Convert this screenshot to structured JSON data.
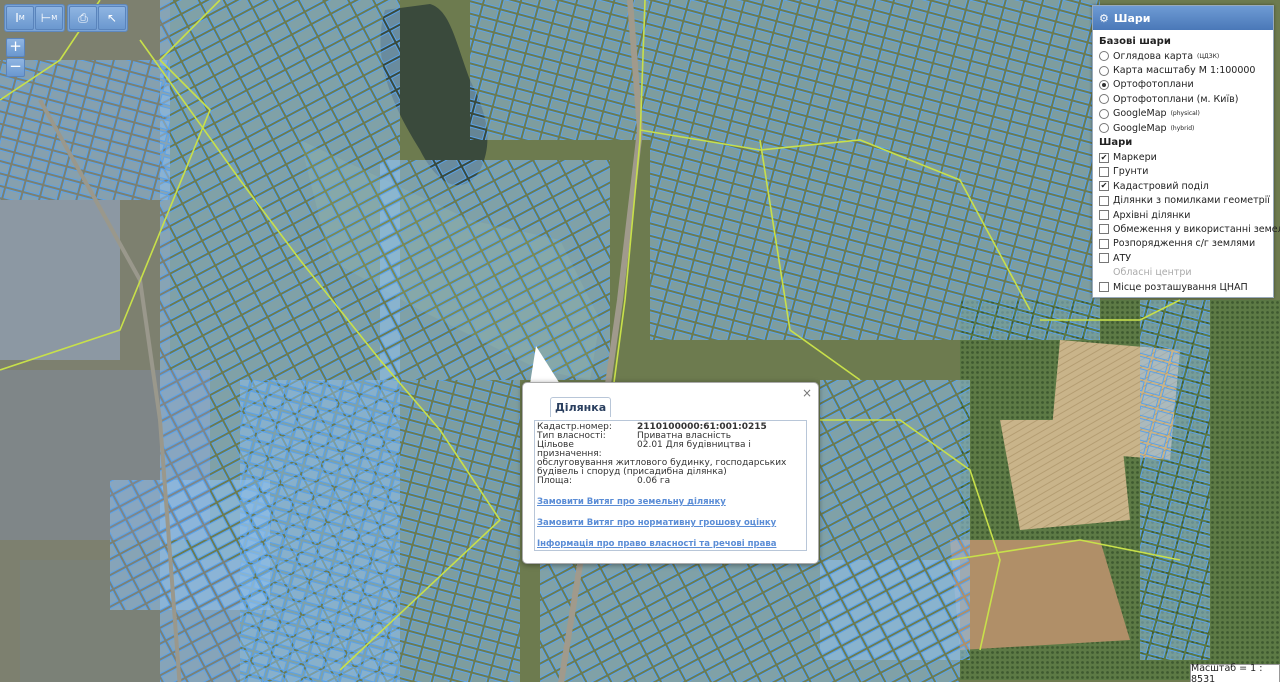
{
  "toolbar": {
    "ruler_label": "М",
    "area_label": "М"
  },
  "zoom": {
    "in": "+",
    "out": "−"
  },
  "layers_panel": {
    "title": "Шари",
    "base_section": "Базові шари",
    "base_layers": [
      {
        "label": "Оглядова карта",
        "sup": "(ЦДЗК)",
        "selected": false
      },
      {
        "label": "Карта масштабу М 1:100000",
        "sup": "",
        "selected": false
      },
      {
        "label": "Ортофотоплани",
        "sup": "",
        "selected": true
      },
      {
        "label": "Ортофотоплани (м. Київ)",
        "sup": "",
        "selected": false
      },
      {
        "label": "GoogleMap",
        "sup": "(physical)",
        "selected": false
      },
      {
        "label": "GoogleMap",
        "sup": "(hybrid)",
        "selected": false
      }
    ],
    "overlay_section": "Шари",
    "overlays": [
      {
        "label": "Маркери",
        "checked": true
      },
      {
        "label": "Грунти",
        "checked": false
      },
      {
        "label": "Кадастровий поділ",
        "checked": true
      },
      {
        "label": "Ділянки з помилками геометрії",
        "checked": false
      },
      {
        "label": "Архівні ділянки",
        "checked": false
      },
      {
        "label": "Обмеження у використанні земель",
        "checked": false
      },
      {
        "label": "Розпорядження с/г землями",
        "checked": false
      },
      {
        "label": "АТУ",
        "checked": false
      },
      {
        "label": "Обласні центри",
        "checked": false,
        "disabled": true
      },
      {
        "label": "Місце розташування ЦНАП",
        "checked": false
      }
    ]
  },
  "popup": {
    "tab": "Ділянка",
    "close": "×",
    "cadastral_label": "Кадастр.номер:",
    "cadastral_value": "2110100000:61:001:0215",
    "ownership_label": "Тип власності:",
    "ownership_value": "Приватна власність",
    "purpose_label": "Цільове призначення:",
    "purpose_value_1": "02.01 Для будівництва і",
    "purpose_value_2": "обслуговування житлового будинку, господарських будівель і споруд (присадибна ділянка)",
    "area_label": "Площа:",
    "area_value": "0.06 га",
    "links": [
      "Замовити Витяг про земельну ділянку",
      "Замовити Витяг про нормативну грошову оцінку",
      "Інформація про право власності та речові права"
    ]
  },
  "scale": "Масштаб = 1 : 8531",
  "colors": {
    "parcel_fill": "#7fb6e8",
    "parcel_stroke": "#4f95df",
    "boundary": "#c8e04a",
    "panel_header": "#5a88c6"
  }
}
